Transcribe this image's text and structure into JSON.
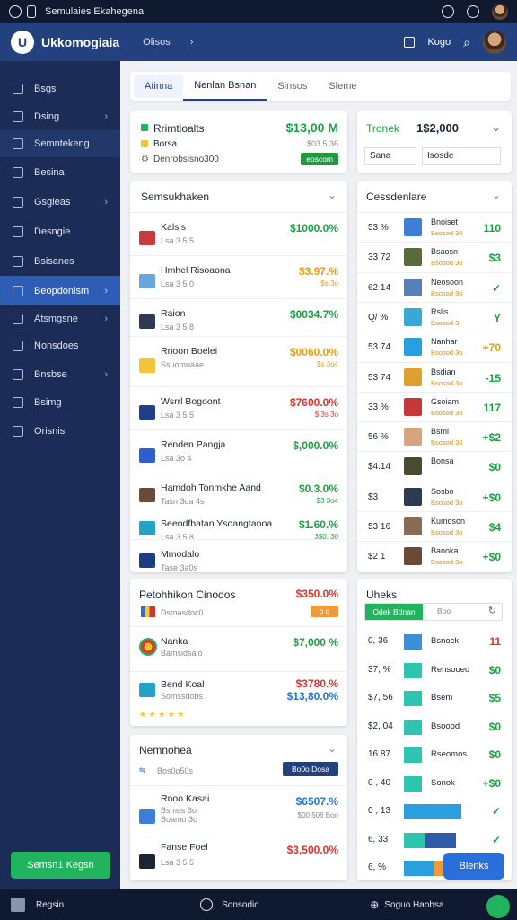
{
  "status": {
    "title": "Semulaies Ekahegena"
  },
  "app": {
    "name": "Ukkomogiaia",
    "crumb": "Olisos",
    "right_label": "Kogo"
  },
  "sidebar": {
    "items": [
      {
        "label": "Bsgs",
        "icon": "home-icon"
      },
      {
        "label": "Dsing",
        "icon": "gauge-icon"
      },
      {
        "label": "Semntekeng",
        "icon": "chart-icon"
      },
      {
        "label": "Besina",
        "icon": "folder-icon"
      },
      {
        "label": "Gsgieas",
        "icon": "grid-icon"
      },
      {
        "label": "Desngie",
        "icon": "calendar-icon"
      },
      {
        "label": "Bsisanes",
        "icon": "tag-icon"
      },
      {
        "label": "Beopdonism",
        "icon": "target-icon"
      },
      {
        "label": "Atsmgsne",
        "icon": "tool-icon"
      },
      {
        "label": "Nonsdoes",
        "icon": "inbox-icon"
      },
      {
        "label": "Bnsbse",
        "icon": "cube-icon"
      },
      {
        "label": "Bsimg",
        "icon": "chat-icon"
      },
      {
        "label": "Orisnis",
        "icon": "box-icon"
      }
    ],
    "button": "Semsn1 Kegsn"
  },
  "tabs": [
    "Atinna",
    "Nenlan  Bsnan",
    "Sinsos",
    "Sleme"
  ],
  "summary": {
    "title": "Rrimtioalts",
    "value": "$13,00 M",
    "l2": "Borsa",
    "s2": "$03 5 36",
    "l3": "Denrobsisno300",
    "badge": "eoscom"
  },
  "picker": {
    "label": "Tronek",
    "value": "1$2,000",
    "f1": "Sana",
    "f2": "Isosde"
  },
  "list1": {
    "title": "Semsukhaken",
    "rows": [
      {
        "name": "Kalsis",
        "sub": "Lsa 3 5 5",
        "val": "$1000.0%",
        "sub2": "",
        "c": "green",
        "t": "#c93b3b"
      },
      {
        "name": "Hmhel Risoaona",
        "sub": "Lsa 3 5 0",
        "val": "$3.97.%",
        "sub2": "$s 3o",
        "c": "orange",
        "t": "#6aa6e0"
      },
      {
        "name": "Raion",
        "sub": "Lsa 3 5 8",
        "val": "$0034.7%",
        "sub2": "",
        "c": "green",
        "t": "#2c3b52"
      },
      {
        "name": "Rnoon Boelei",
        "sub": "Ssuomuaae",
        "val": "$0060.0%",
        "sub2": "$s 3o4",
        "c": "orange",
        "t": "#f4c434"
      },
      {
        "name": "Wsrrl Bogoont",
        "sub": "Lsa 3 5 5",
        "val": "$7600.0%",
        "sub2": "$ 3s 3o",
        "c": "red",
        "t": "#1e3f8a"
      },
      {
        "name": "Renden Pangja",
        "sub": "Lsa 3o 4",
        "val": "$,000.0%",
        "sub2": "",
        "c": "green",
        "t": "#2d5fd1"
      },
      {
        "name": "Hamdoh Tonmkhe Aand",
        "sub": "Tasn 3da 4s",
        "val": "$0.3.0%",
        "sub2": "$3 3o4",
        "c": "green",
        "t": "#6b4a38"
      },
      {
        "name": "Seeodfbatan Ysoangtanoa",
        "sub": "Lsa 3 5 8",
        "val": "$1.60.%",
        "sub2": "3$0. 30",
        "c": "green",
        "t": "#22a4c9"
      },
      {
        "name": "Mmodalo",
        "sub": "Tase 3a0s",
        "val": "",
        "sub2": "",
        "c": "green",
        "t": "#1b3d82"
      }
    ]
  },
  "list2": {
    "title": "Cessdenlare",
    "rows": [
      {
        "pct": "53 %",
        "name": "Bnoiset",
        "sub": "Bsosod 30",
        "val": "110",
        "c": "green",
        "t": "#3d7fd8"
      },
      {
        "pct": "33 72",
        "name": "Bsaosn",
        "sub": "Bsosod 30",
        "val": "$3",
        "c": "green",
        "t": "#5a6b3b"
      },
      {
        "pct": "62 14",
        "name": "Neosoon",
        "sub": "Bsosod 3o",
        "val": "✓",
        "c": "green",
        "t": "#5a7fb8"
      },
      {
        "pct": "Q/ %",
        "name": "Rslis",
        "sub": "Bsosod 3",
        "val": "Y",
        "c": "green",
        "t": "#3aa7d8"
      },
      {
        "pct": "53 74",
        "name": "Nanhar",
        "sub": "Bsosod 3o",
        "val": "+70",
        "c": "orange",
        "t": "#2a9fe0"
      },
      {
        "pct": "53 74",
        "name": "Bsdian",
        "sub": "Bsosod 3o",
        "val": "-15",
        "c": "green",
        "t": "#e0a030"
      },
      {
        "pct": "33 %",
        "name": "Gsoiam",
        "sub": "Bsosod 3o",
        "val": "117",
        "c": "green",
        "t": "#c43a3a"
      },
      {
        "pct": "56 %",
        "name": "Bsml",
        "sub": "Bsosod 30",
        "val": "+$2",
        "c": "green",
        "t": "#d8a37f"
      },
      {
        "pct": "$4.14",
        "name": "Bonsa",
        "sub": "",
        "val": "$0",
        "c": "green",
        "t": "#4a4a30"
      },
      {
        "pct": "$3",
        "name": "Sosbo",
        "sub": "Bsosod 3o",
        "val": "+$0",
        "c": "green",
        "t": "#2c3b52"
      },
      {
        "pct": "53 16",
        "name": "Kumoson",
        "sub": "Bsosod 3o",
        "val": "$4",
        "c": "green",
        "t": "#8a6b55"
      },
      {
        "pct": "$2 1",
        "name": "Banoka",
        "sub": "Bsosod 3o",
        "val": "+$0",
        "c": "green",
        "t": "#6b4a38"
      }
    ]
  },
  "list3": {
    "title": "Petohhikon Cinodos",
    "val": "$350.0%",
    "sub": "Dsmasdoc0",
    "badge": "o o",
    "rows": [
      {
        "name": "Nanka",
        "sub": "Bamsidsalo",
        "val": "$7,000 %",
        "c": "green",
        "t": "#e03a2a"
      },
      {
        "name": "Bend Koal",
        "sub": "Somssdobs",
        "val": "$3780.%",
        "val2": "$13,80.0%",
        "c": "red",
        "t": "#22a4c9"
      }
    ]
  },
  "list4": {
    "title": "Nemnohea",
    "sub": "Bos0o50s",
    "btn": "Bo0o Dosa",
    "rows": [
      {
        "name": "Rnoo Kasai",
        "sub": "Bsmos 3o\nBoamo 3o",
        "val": "$6507.%",
        "val2": "$00 506 Boo",
        "c": "blue",
        "t": "#3d7fd8"
      },
      {
        "name": "Fanse Foel",
        "sub": "Lsa 3 5 5",
        "val": "$3,500.0%",
        "c": "red",
        "t": "#1b2533"
      }
    ]
  },
  "list5": {
    "title": "Uheks",
    "btn_a": "Odek Bdnan",
    "btn_b": "Boo",
    "rows": [
      {
        "pct": "0, 36",
        "name": "Bsnock",
        "val": "11",
        "c": "red",
        "w": 20,
        "col": "#3d8fd8"
      },
      {
        "pct": "37, %",
        "name": "Rensooed",
        "val": "$0",
        "c": "green",
        "w": 20,
        "col": "#2ec4b0"
      },
      {
        "pct": "$7, 56",
        "name": "Bsem",
        "val": "$5",
        "c": "green",
        "w": 20,
        "col": "#2ec4b0"
      },
      {
        "pct": "$2, 04",
        "name": "Bsoood",
        "val": "$0",
        "c": "green",
        "w": 20,
        "col": "#2ec4b0"
      },
      {
        "pct": "16 87",
        "name": "Rseomos",
        "val": "$0",
        "c": "green",
        "w": 20,
        "col": "#2ec4b0"
      },
      {
        "pct": "0 , 40",
        "name": "Sonok",
        "val": "+$0",
        "c": "green",
        "w": 20,
        "col": "#2ec4b0"
      },
      {
        "pct": "0 , 13",
        "name": "",
        "val": "✓",
        "c": "green",
        "w": 64,
        "col": "#2a9fe0"
      },
      {
        "pct": "6, 33",
        "name": "",
        "val": "✓",
        "c": "green",
        "w": 58,
        "col": "#2ec4b0"
      },
      {
        "pct": "6, %",
        "name": "",
        "val": "",
        "c": "green",
        "w": 56,
        "col": "#2a9fe0"
      }
    ],
    "cta": "Blenks"
  },
  "bottom": {
    "left": "Regsin",
    "mid": "Sonsodic",
    "right": "Soguo Haobsa"
  }
}
